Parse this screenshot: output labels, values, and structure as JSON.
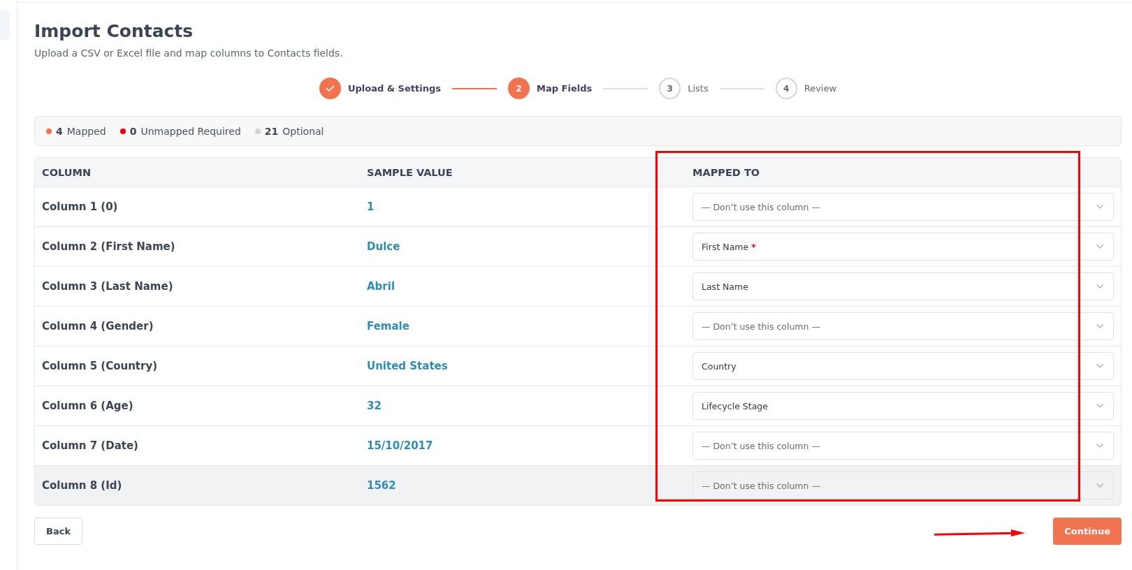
{
  "page": {
    "title": "Import Contacts",
    "subtitle": "Upload a CSV or Excel file and map columns to Contacts fields."
  },
  "stepper": {
    "steps": [
      {
        "label": "Upload & Settings",
        "completed": true,
        "selected": false
      },
      {
        "number": "2",
        "label": "Map Fields",
        "completed": false,
        "selected": true
      },
      {
        "number": "3",
        "label": "Lists",
        "completed": false,
        "selected": false
      },
      {
        "number": "4",
        "label": "Review",
        "completed": false,
        "selected": false
      }
    ]
  },
  "legend": [
    {
      "count": "4",
      "label": "Mapped",
      "color": "#f2734f"
    },
    {
      "count": "0",
      "label": "Unmapped Required",
      "color": "#e3000f"
    },
    {
      "count": "21",
      "label": "Optional",
      "color": "#d4d4d4"
    }
  ],
  "table": {
    "columns": [
      "COLUMN",
      "SAMPLE VALUE",
      "MAPPED TO"
    ],
    "rows": [
      {
        "column": "Column 1 (0)",
        "sample_value": "1",
        "mapped_to": "— Don’t use this column —",
        "mapped": false,
        "hovered": false
      },
      {
        "column": "Column 2 (First Name)",
        "sample_value": "Dulce",
        "mapped_to": "First Name",
        "required_mark": "*",
        "mapped": true,
        "hovered": false
      },
      {
        "column": "Column 3 (Last Name)",
        "sample_value": "Abril",
        "mapped_to": "Last Name",
        "mapped": true,
        "hovered": false
      },
      {
        "column": "Column 4 (Gender)",
        "sample_value": "Female",
        "mapped_to": "— Don’t use this column —",
        "mapped": false,
        "hovered": false
      },
      {
        "column": "Column 5 (Country)",
        "sample_value": "United States",
        "mapped_to": "Country",
        "mapped": true,
        "hovered": false
      },
      {
        "column": "Column 6 (Age)",
        "sample_value": "32",
        "mapped_to": "Lifecycle Stage",
        "mapped": true,
        "hovered": false
      },
      {
        "column": "Column 7 (Date)",
        "sample_value": "15/10/2017",
        "mapped_to": "— Don’t use this column —",
        "mapped": false,
        "hovered": false
      },
      {
        "column": "Column 8 (Id)",
        "sample_value": "1562",
        "mapped_to": "— Don’t use this column —",
        "mapped": false,
        "hovered": true
      }
    ]
  },
  "annotations": {
    "frame": true,
    "arrow": true
  },
  "buttons": [
    {
      "label": "Back",
      "kind": "secondary"
    },
    {
      "label": "Continue",
      "kind": "primary"
    }
  ]
}
